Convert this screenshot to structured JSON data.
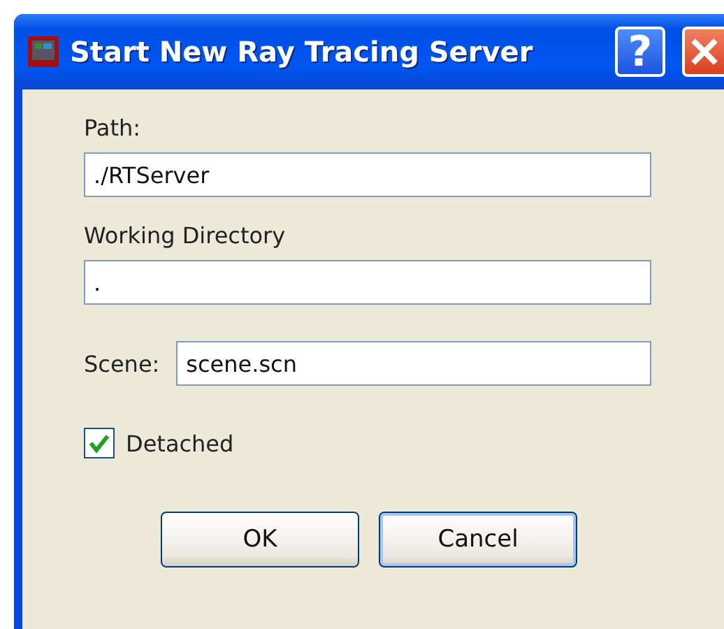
{
  "window": {
    "title": "Start New Ray Tracing Server",
    "buttons": [
      "?"
    ]
  },
  "fields": [
    {
      "label": "Path:",
      "value": "./RTServer",
      "kind": "stacked"
    },
    {
      "label": "Working Directory",
      "value": ".",
      "kind": "stacked"
    },
    {
      "label": "Scene:",
      "value": "scene.scn",
      "kind": "inline"
    }
  ],
  "detached": {
    "label": "Detached",
    "checked": true
  },
  "buttons": [
    {
      "label": "OK",
      "focused": false
    },
    {
      "label": "Cancel",
      "focused": true
    }
  ]
}
